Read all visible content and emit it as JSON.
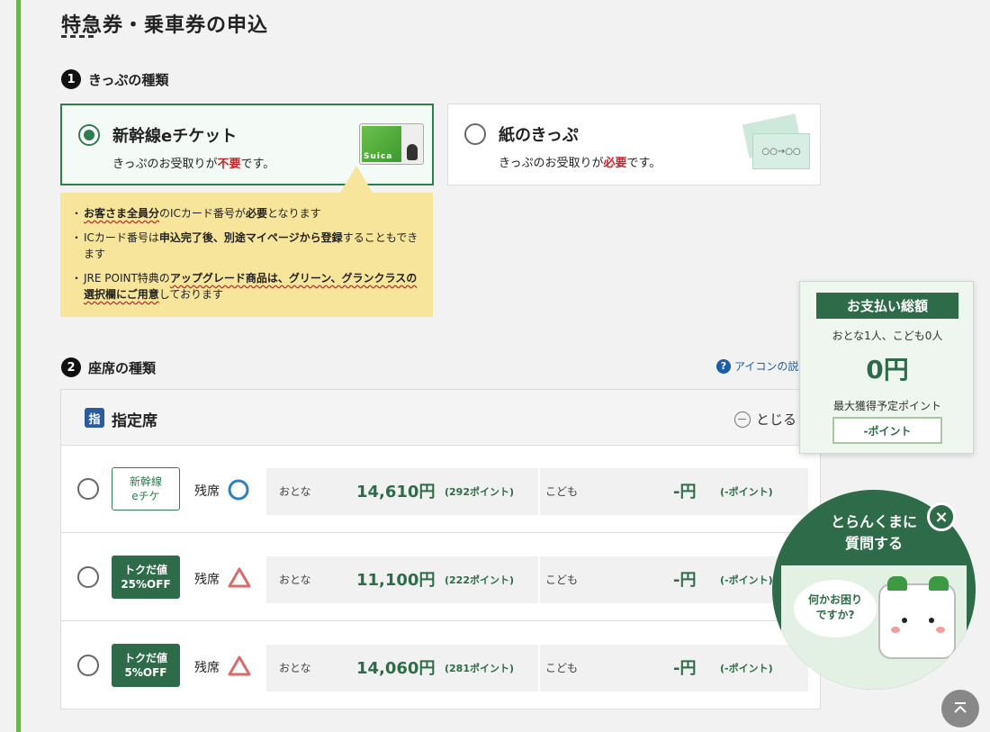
{
  "page": {
    "title": "特急券・乗車券の申込"
  },
  "section1": {
    "number": "1",
    "heading": "きっぷの種類",
    "options": [
      {
        "title": "新幹線eチケット",
        "desc_pre": "きっぷのお受取りが",
        "desc_emph": "不要",
        "desc_post": "です。",
        "card_text": "Suica",
        "selected": true
      },
      {
        "title": "紙のきっぷ",
        "desc_pre": "きっぷのお受取りが",
        "desc_emph": "必要",
        "desc_post": "です。",
        "ticket_text": "○○→○○",
        "selected": false
      }
    ],
    "notices": [
      {
        "parts": [
          [
            "お客さま全員分",
            "u"
          ],
          [
            "のICカード番号が",
            ""
          ],
          [
            "必要",
            "b"
          ],
          [
            "となります",
            ""
          ]
        ]
      },
      {
        "parts": [
          [
            "ICカード番号は",
            ""
          ],
          [
            "申込完了後、別途マイページから登録",
            "b"
          ],
          [
            "することもできます",
            ""
          ]
        ]
      },
      {
        "parts": [
          [
            "JRE POINT特典の",
            ""
          ],
          [
            "アップグレード商品は、グリーン、グランクラスの選択欄にご用意",
            "u"
          ],
          [
            "しております",
            ""
          ]
        ]
      }
    ]
  },
  "section2": {
    "number": "2",
    "heading": "座席の種類",
    "help_link": "アイコンの説",
    "seat_class_badge": "指",
    "seat_class": "指定席",
    "collapse_label": "とじる",
    "rows": [
      {
        "tag_line1": "新幹線",
        "tag_line2": "eチケ",
        "tag_style": "outline",
        "availability_label": "残席",
        "availability": "circle",
        "adult_label": "おとな",
        "adult_price": "14,610円",
        "adult_points": "(292ポイント)",
        "child_label": "こども",
        "child_price": "-円",
        "child_points": "(-ポイント)"
      },
      {
        "tag_line1": "トクだ値",
        "tag_line2": "25%OFF",
        "tag_style": "filled",
        "availability_label": "残席",
        "availability": "triangle",
        "adult_label": "おとな",
        "adult_price": "11,100円",
        "adult_points": "(222ポイント)",
        "child_label": "こども",
        "child_price": "-円",
        "child_points": "(-ポイント)"
      },
      {
        "tag_line1": "トクだ値",
        "tag_line2": "5%OFF",
        "tag_style": "filled",
        "availability_label": "残席",
        "availability": "triangle",
        "adult_label": "おとな",
        "adult_price": "14,060円",
        "adult_points": "(281ポイント)",
        "child_label": "こども",
        "child_price": "-円",
        "child_points": "(-ポイント)"
      }
    ]
  },
  "payment": {
    "title": "お支払い総額",
    "people": "おとな1人、こども0人",
    "total": "0円",
    "points_label": "最大獲得予定ポイント",
    "points": "-ポイント"
  },
  "chat": {
    "title_line1": "とらんくまに",
    "title_line2": "質問する",
    "bubble_line1": "何かお困り",
    "bubble_line2": "ですか?",
    "close_icon": "close-icon"
  },
  "colors": {
    "brand_green": "#2e6b48",
    "accent_green": "#6bb34a",
    "warn_red": "#c0262d",
    "notice_yellow": "#f8e59c",
    "link_blue": "#1a5ea8"
  }
}
